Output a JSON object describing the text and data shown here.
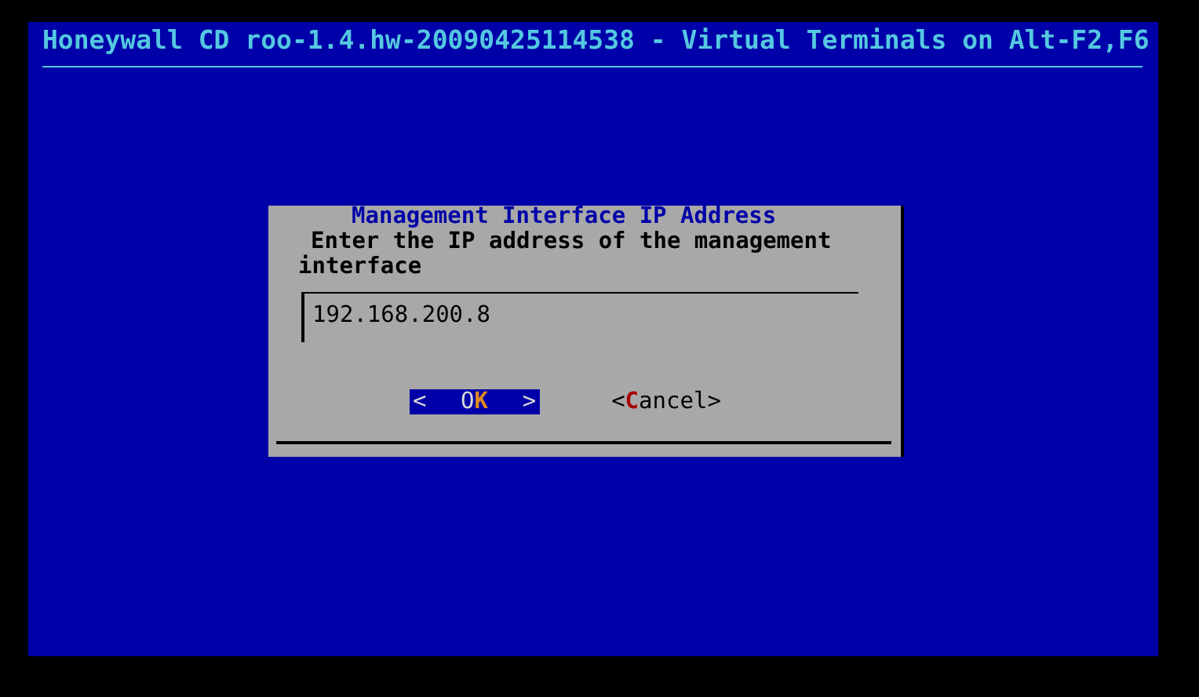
{
  "header": {
    "title": "Honeywall CD roo-1.4.hw-20090425114538 - Virtual Terminals on Alt-F2,F6"
  },
  "dialog": {
    "title": "Management Interface IP Address",
    "prompt": "Enter the IP address of the management interface",
    "input": {
      "value": "192.168.200.8"
    },
    "buttons": [
      {
        "open": "<",
        "before": "O",
        "hotkey": "K",
        "close": ">",
        "selected": true
      },
      {
        "open": "<",
        "hotkey": "C",
        "after": "ancel",
        "close": ">",
        "selected": false
      }
    ]
  }
}
